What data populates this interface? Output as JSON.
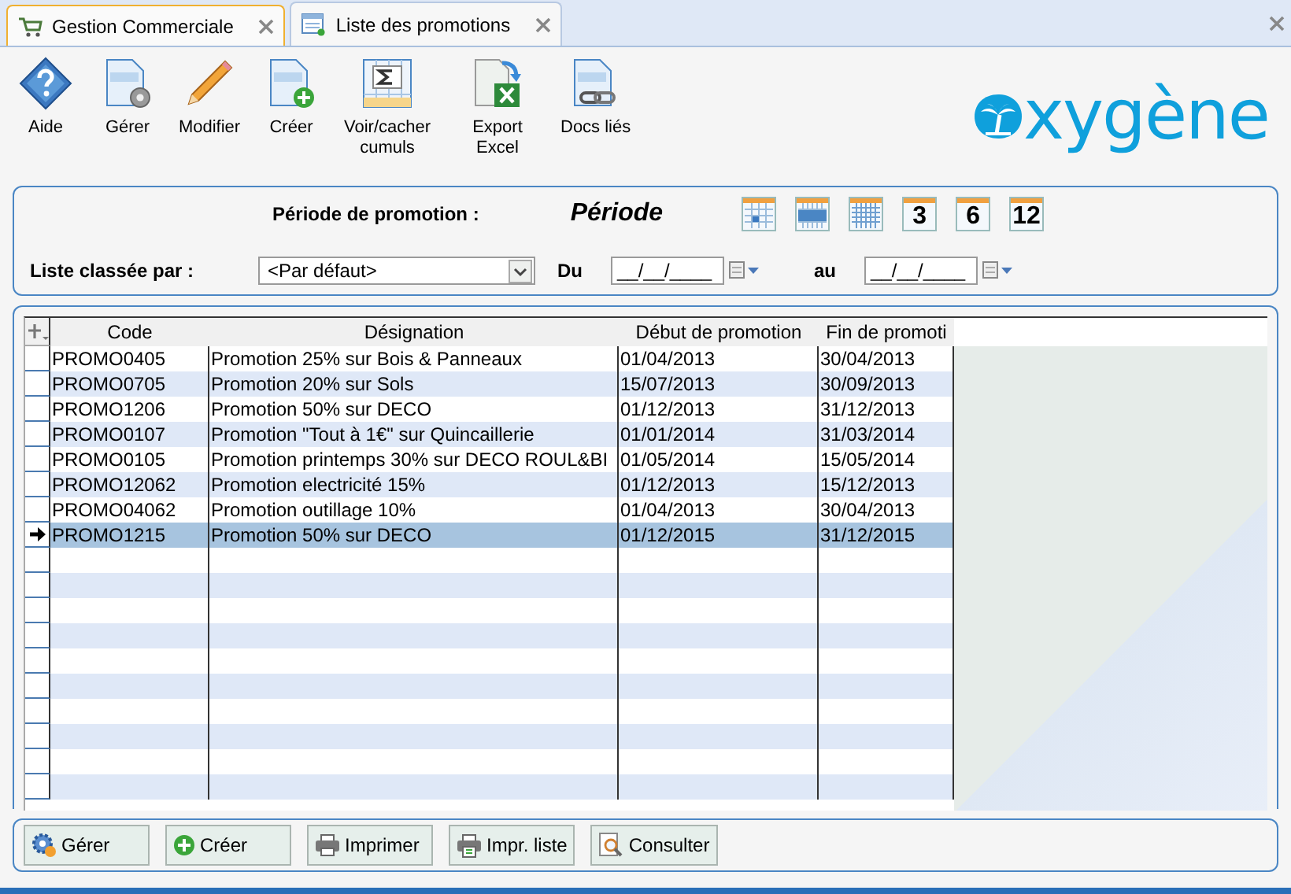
{
  "tabs": [
    {
      "label": "Gestion Commerciale",
      "selected": false,
      "highlighted": true
    },
    {
      "label": "Liste des promotions",
      "selected": true,
      "highlighted": false
    }
  ],
  "toolbar": [
    {
      "label": "Aide"
    },
    {
      "label": "Gérer"
    },
    {
      "label": "Modifier"
    },
    {
      "label": "Créer"
    },
    {
      "label": "Voir/cacher cumuls"
    },
    {
      "label": "Export Excel"
    },
    {
      "label": "Docs liés"
    }
  ],
  "logo": {
    "text": "xygène"
  },
  "filters": {
    "period_label": "Période de promotion :",
    "period_title": "Période",
    "period_buttons": [
      {
        "kind": "day"
      },
      {
        "kind": "week"
      },
      {
        "kind": "month"
      },
      {
        "kind": "number",
        "label": "3"
      },
      {
        "kind": "number",
        "label": "6"
      },
      {
        "kind": "number",
        "label": "12"
      }
    ],
    "sort_label": "Liste classée par :",
    "sort_value": "<Par défaut>",
    "from_label": "Du",
    "from_value": "__/__/____",
    "to_label": "au",
    "to_value": "__/__/____"
  },
  "table": {
    "columns": [
      "Code",
      "Désignation",
      "Début de promotion",
      "Fin de promoti"
    ],
    "rows": [
      {
        "cells": [
          "PROMO0405",
          "Promotion 25% sur Bois & Panneaux",
          "01/04/2013",
          "30/04/2013"
        ],
        "selected": false
      },
      {
        "cells": [
          "PROMO0705",
          "Promotion 20% sur Sols",
          "15/07/2013",
          "30/09/2013"
        ],
        "selected": false
      },
      {
        "cells": [
          "PROMO1206",
          "Promotion 50% sur DECO",
          "01/12/2013",
          "31/12/2013"
        ],
        "selected": false
      },
      {
        "cells": [
          "PROMO0107",
          "Promotion \"Tout à 1€\" sur Quincaillerie",
          "01/01/2014",
          "31/03/2014"
        ],
        "selected": false
      },
      {
        "cells": [
          "PROMO0105",
          "Promotion printemps 30% sur DECO ROUL&BI",
          "01/05/2014",
          "15/05/2014"
        ],
        "selected": false
      },
      {
        "cells": [
          "PROMO12062",
          "Promotion electricité 15%",
          "01/12/2013",
          "15/12/2013"
        ],
        "selected": false
      },
      {
        "cells": [
          "PROMO04062",
          "Promotion outillage 10%",
          "01/04/2013",
          "30/04/2013"
        ],
        "selected": false
      },
      {
        "cells": [
          "PROMO1215",
          "Promotion 50% sur DECO",
          "01/12/2015",
          "31/12/2015"
        ],
        "selected": true
      }
    ]
  },
  "buttons": [
    {
      "label": "Gérer"
    },
    {
      "label": "Créer"
    },
    {
      "label": "Imprimer"
    },
    {
      "label": "Impr. liste"
    },
    {
      "label": "Consulter"
    }
  ]
}
